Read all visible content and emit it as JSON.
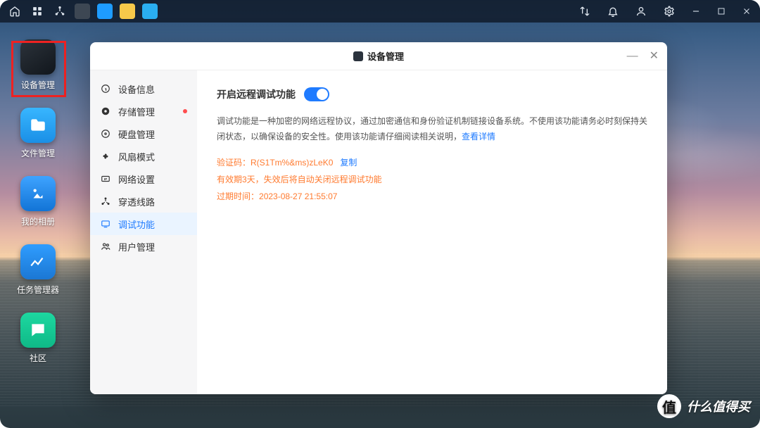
{
  "taskbar": {
    "apps": [
      "home",
      "apps",
      "network",
      "device-manager",
      "docker",
      "file-notes",
      "file-manager"
    ],
    "right_icons": [
      "transfer",
      "bell",
      "user",
      "gear"
    ],
    "window_controls": [
      "minimize",
      "maximize",
      "close"
    ]
  },
  "desktop_icons": [
    {
      "id": "device-manager",
      "label": "设备管理",
      "style": "dark"
    },
    {
      "id": "file-manager",
      "label": "文件管理",
      "style": "folder"
    },
    {
      "id": "my-photos",
      "label": "我的相册",
      "style": "photos"
    },
    {
      "id": "task-manager",
      "label": "任务管理器",
      "style": "task"
    },
    {
      "id": "community",
      "label": "社区",
      "style": "chat"
    }
  ],
  "window": {
    "title": "设备管理",
    "controls": {
      "minimize": "—",
      "close": "✕"
    }
  },
  "sidebar": {
    "items": [
      {
        "icon": "info",
        "label": "设备信息",
        "active": false,
        "dot": false
      },
      {
        "icon": "storage",
        "label": "存储管理",
        "active": false,
        "dot": true
      },
      {
        "icon": "disk",
        "label": "硬盘管理",
        "active": false,
        "dot": false
      },
      {
        "icon": "fan",
        "label": "风扇模式",
        "active": false,
        "dot": false
      },
      {
        "icon": "ip",
        "label": "网络设置",
        "active": false,
        "dot": false
      },
      {
        "icon": "route",
        "label": "穿透线路",
        "active": false,
        "dot": false
      },
      {
        "icon": "debug",
        "label": "调试功能",
        "active": true,
        "dot": false
      },
      {
        "icon": "users",
        "label": "用户管理",
        "active": false,
        "dot": false
      }
    ]
  },
  "content": {
    "toggle_label": "开启远程调试功能",
    "toggle_on": true,
    "desc_part1": "调试功能是一种加密的网络远程协议，通过加密通信和身份验证机制链接设备系统。不使用该功能请务必时刻保持关闭状态，以确保设备的安全性。使用该功能请仔细阅读相关说明，",
    "desc_link": "查看详情",
    "code_key": "验证码：",
    "code_val": "R(S1Tm%&ms)zLeK0",
    "copy": "复制",
    "expire_note": "有效期3天，失效后将自动关闭远程调试功能",
    "expire_key": "过期时间：",
    "expire_val": "2023-08-27 21:55:07"
  },
  "watermark": "什么值得买"
}
